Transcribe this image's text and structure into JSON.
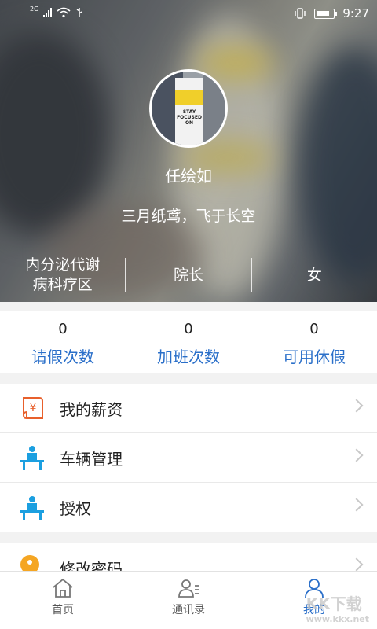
{
  "status_bar": {
    "network": "2G",
    "time": "9:27"
  },
  "profile": {
    "name": "任绘如",
    "motto": "三月纸鸢，飞于长空",
    "department": "内分泌代谢病科疗区",
    "department_line1": "内分泌代谢",
    "department_line2": "病科疗区",
    "position": "院长",
    "gender": "女"
  },
  "stats": [
    {
      "value": "0",
      "label": "请假次数"
    },
    {
      "value": "0",
      "label": "加班次数"
    },
    {
      "value": "0",
      "label": "可用休假"
    }
  ],
  "menu": [
    {
      "label": "我的薪资",
      "icon": "salary-icon"
    },
    {
      "label": "车辆管理",
      "icon": "person-desk-icon"
    },
    {
      "label": "授权",
      "icon": "person-desk-icon"
    }
  ],
  "menu2": [
    {
      "label": "修改密码",
      "icon": "key-icon"
    }
  ],
  "tabs": [
    {
      "label": "首页",
      "icon": "home-icon"
    },
    {
      "label": "通讯录",
      "icon": "contacts-icon"
    },
    {
      "label": "我的",
      "icon": "profile-icon"
    }
  ],
  "watermark": {
    "brand": "KK下载",
    "url": "www.kkx.net"
  },
  "colors": {
    "accent": "#2a6fc9",
    "salary_icon": "#e8602c",
    "person_icon": "#1b9fe0",
    "key_icon": "#f5a623"
  }
}
